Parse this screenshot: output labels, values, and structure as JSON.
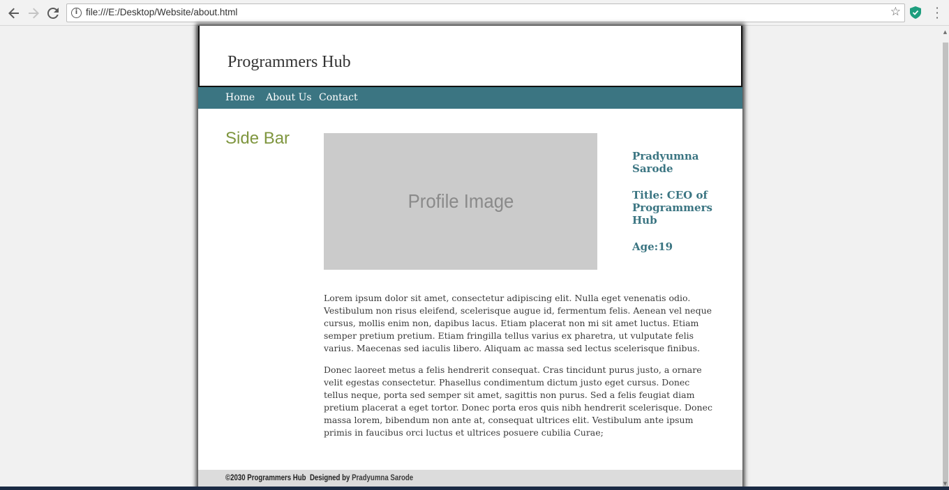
{
  "browser": {
    "url": "file:///E:/Desktop/Website/about.html",
    "back_icon": "arrow-left-icon",
    "forward_icon": "arrow-right-icon",
    "reload_icon": "reload-icon",
    "info_icon": "info-icon",
    "bookmark_icon": "star-icon",
    "extension_icon": "shield-icon",
    "menu_icon": "kebab-menu-icon"
  },
  "header": {
    "site_title": "Programmers Hub"
  },
  "nav": {
    "home": "Home",
    "about": "About Us",
    "contact": "Contact"
  },
  "sidebar": {
    "title": "Side Bar"
  },
  "profile": {
    "image_label": "Profile Image",
    "name": "Pradyumna Sarode",
    "title": "Title: CEO of Programmers Hub",
    "age": "Age:19"
  },
  "content": {
    "paragraph1": "Lorem ipsum dolor sit amet, consectetur adipiscing elit. Nulla eget venenatis odio. Vestibulum non risus eleifend, scelerisque augue id, fermentum felis. Aenean vel neque cursus, mollis enim non, dapibus lacus. Etiam placerat non mi sit amet luctus. Etiam semper pretium pretium. Etiam fringilla tellus varius ex pharetra, ut vulputate felis varius. Maecenas sed iaculis libero. Aliquam ac massa sed lectus scelerisque finibus.",
    "paragraph2": "Donec laoreet metus a felis hendrerit consequat. Cras tincidunt purus justo, a ornare velit egestas consectetur. Phasellus condimentum dictum justo eget cursus. Donec tellus neque, porta sed semper sit amet, sagittis non purus. Sed a felis feugiat diam pretium placerat a eget tortor. Donec porta eros quis nibh hendrerit scelerisque. Donec massa lorem, bibendum non ante at, consequat ultrices elit. Vestibulum ante ipsum primis in faucibus orci luctus et ultrices posuere cubilia Curae;"
  },
  "footer": {
    "copyright": "©2030 Programmers Hub",
    "designed_by": "Designed by",
    "author": "Pradyumna Sarode"
  },
  "colors": {
    "nav_bg": "#3b7582",
    "sidebar_title": "#7f963f",
    "profile_text": "#3b7582",
    "footer_bg": "#dcdcdc"
  }
}
